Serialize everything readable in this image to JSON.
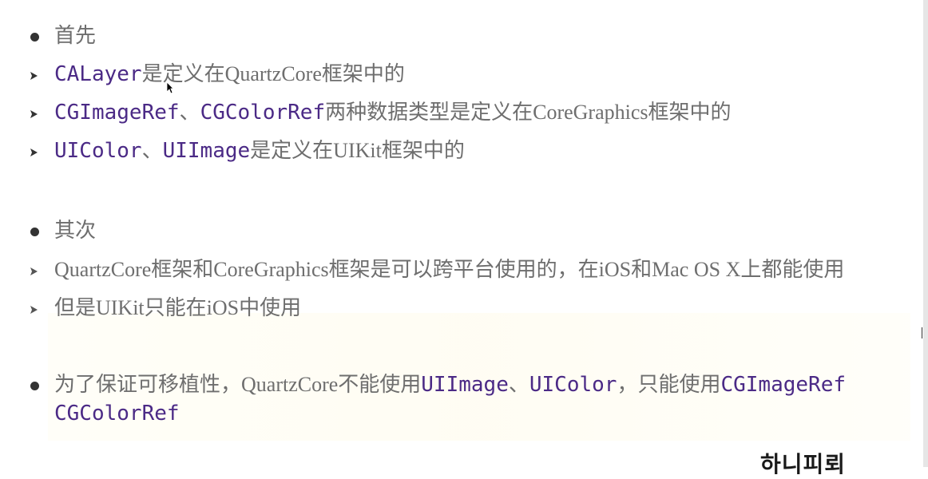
{
  "sections": [
    {
      "heading": "首先",
      "items": [
        {
          "parts": [
            {
              "t": "code",
              "v": "CALayer"
            },
            {
              "t": "plain",
              "v": "是定义在QuartzCore框架中的"
            }
          ]
        },
        {
          "parts": [
            {
              "t": "code",
              "v": "CGImageRef"
            },
            {
              "t": "plain",
              "v": "、"
            },
            {
              "t": "code",
              "v": "CGColorRef"
            },
            {
              "t": "plain",
              "v": "两种数据类型是定义在CoreGraphics框架中的"
            }
          ]
        },
        {
          "parts": [
            {
              "t": "code",
              "v": "UIColor"
            },
            {
              "t": "plain",
              "v": "、"
            },
            {
              "t": "code",
              "v": "UIImage"
            },
            {
              "t": "plain",
              "v": "是定义在UIKit框架中的"
            }
          ]
        }
      ]
    },
    {
      "heading": "其次",
      "items": [
        {
          "parts": [
            {
              "t": "plain",
              "v": "QuartzCore框架和CoreGraphics框架是可以跨平台使用的，在iOS和Mac OS X上都能使用"
            }
          ]
        },
        {
          "parts": [
            {
              "t": "plain",
              "v": "但是UIKit只能在iOS中使用"
            }
          ]
        }
      ]
    },
    {
      "heading_parts": [
        {
          "t": "plain",
          "v": "为了保证可移植性，QuartzCore不能使用"
        },
        {
          "t": "code",
          "v": "UIImage"
        },
        {
          "t": "plain",
          "v": "、"
        },
        {
          "t": "code",
          "v": "UIColor"
        },
        {
          "t": "plain",
          "v": "，只能使用"
        },
        {
          "t": "code",
          "v": "CGImageRef"
        }
      ],
      "heading_cont": "CGColorRef"
    }
  ],
  "logo_text": "하니피뢰"
}
